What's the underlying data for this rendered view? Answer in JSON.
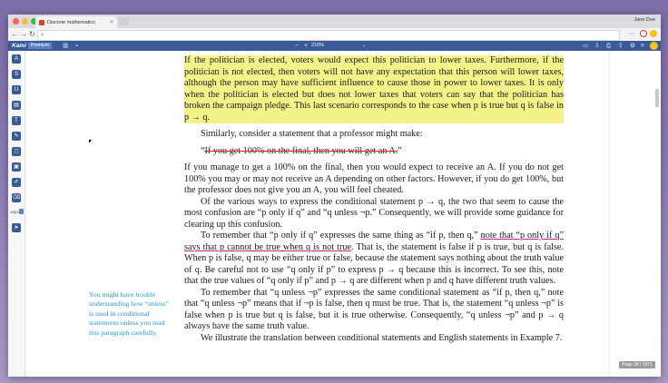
{
  "browser": {
    "tab_title": "Discrete mathematics",
    "tab_close": "×",
    "user_name": "Jane Doe"
  },
  "kami": {
    "logo": "Kami",
    "premium": "Premium",
    "zoom_out": "−",
    "zoom_in": "+",
    "zoom_level": "210%",
    "page_counter": "Page 28 / 1071",
    "zoom_tag": "12px"
  },
  "document": {
    "para1": "If the politician is elected, voters would expect this politician to lower taxes. Furthermore, if the politician is not elected, then voters will not have any expectation that this person will lower taxes, although the person may have sufficient influence to cause those in power to lower taxes. It is only when the politician is elected but does not lower taxes that voters can say that the politician has broken the campaign pledge. This last scenario corresponds to the case when p is true but q is false in p → q.",
    "para2": "Similarly, consider a statement that a professor might make:",
    "quote_open": "“",
    "quote_body": "If you get 100% on the final, then you will get an A.",
    "quote_close": "”",
    "para3": "If you manage to get a 100% on the final, then you would expect to receive an A. If you do not get 100% you may or may not receive an A depending on other factors. However, if you do get 100%, but the professor does not give you an A, you will feel cheated.",
    "para4": "Of the various ways to express the conditional statement p → q, the two that seem to cause the most confusion are “p only if q” and “q unless ¬p.” Consequently, we will provide some guidance for clearing up this confusion.",
    "para5_a": "To remember that “p only if q” expresses the same thing as “if p, then q,” ",
    "para5_ul": "note that “p only if q” says that p cannot be true when q is not true",
    "para5_b": ". That is, the statement is false if p is true, but q is false. When p is false, q may be either true or false, because the statement says nothing about the truth value of q. Be careful not to use “q only if p” to express p → q because this is incorrect. To see this, note that the true values of “q only if p” and p → q are different when p and q have different truth values.",
    "para6": "To remember that “q unless ¬p” expresses the same conditional statement as “if p, then q,” note that “q unless ¬p” means that if ¬p is false, then q must be true. That is, the statement “q unless ¬p” is false when p is true but q is false, but it is true otherwise. Consequently, “q unless ¬p” and p → q always have the same truth value.",
    "para7": "We illustrate the translation between conditional statements and English statements in Example 7.",
    "side_note": "You might have trouble understanding how “unless” is used in conditional statements unless you read this paragraph carefully."
  },
  "colors": {
    "highlight": "#f3f38a",
    "strike": "#d21b1b",
    "underline": "#c2258c",
    "side_note": "#1f98d6",
    "toolbar": "#3a5a98"
  },
  "icons": [
    "back-arrow-icon",
    "forward-arrow-icon",
    "refresh-icon",
    "search-icon",
    "sidebar-toggle-icon",
    "folder-icon",
    "save-icon",
    "print-icon",
    "share-icon",
    "settings-icon",
    "menu-icon",
    "zoom-chevron-icon"
  ],
  "tools": [
    {
      "name": "select-tool",
      "glyph": "A"
    },
    {
      "name": "strikethrough-tool",
      "glyph": "S"
    },
    {
      "name": "underline-tool",
      "glyph": "U"
    },
    {
      "name": "comment-tool",
      "glyph": "▤"
    },
    {
      "name": "text-tool",
      "glyph": "T"
    },
    {
      "name": "pen-tool",
      "glyph": "✎"
    },
    {
      "name": "shape-tool",
      "glyph": "◻"
    },
    {
      "name": "image-tool",
      "glyph": "▣"
    },
    {
      "name": "drawing-tool",
      "glyph": "✐"
    },
    {
      "name": "eraser-tool",
      "glyph": "⌫"
    },
    {
      "name": "pointer-tool",
      "glyph": "➤"
    }
  ]
}
